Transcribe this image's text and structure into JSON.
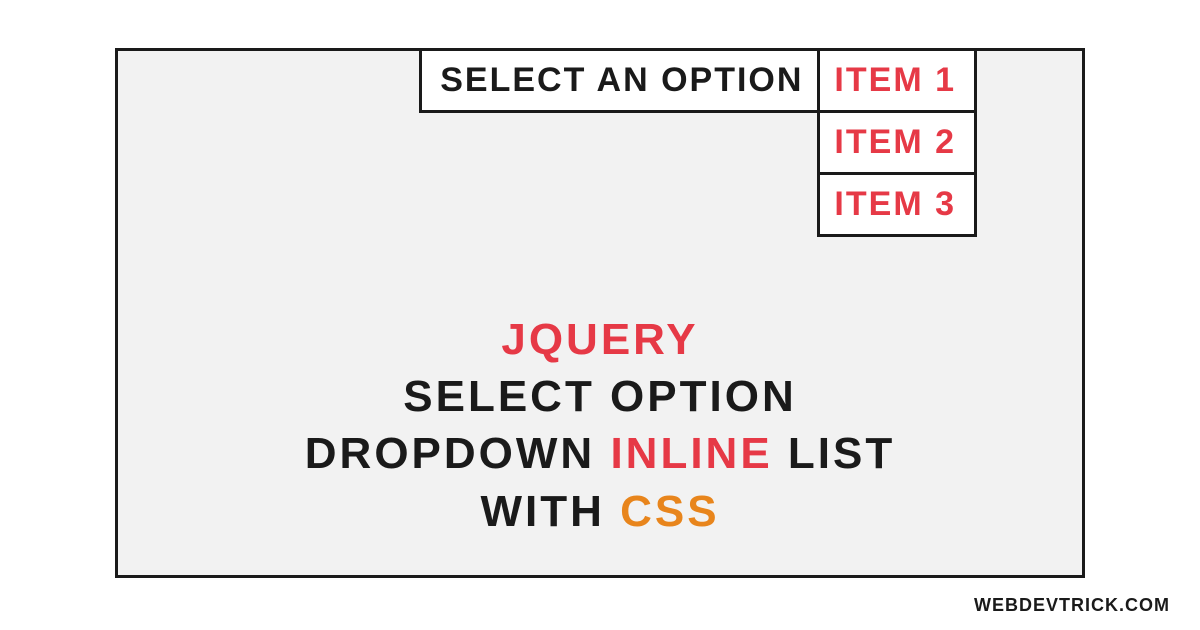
{
  "dropdown": {
    "label": "SELECT AN OPTION",
    "items": [
      "ITEM 1",
      "ITEM 2",
      "ITEM 3"
    ]
  },
  "title": {
    "word1": "JQUERY",
    "word2": "SELECT OPTION",
    "word3a": "DROPDOWN",
    "word3b": "INLINE",
    "word3c": "LIST",
    "word4a": "WITH",
    "word4b": "CSS"
  },
  "watermark": "WEBDEVTRICK.COM",
  "colors": {
    "red": "#e63946",
    "dark": "#1a1a1a",
    "orange": "#e8851c",
    "bg": "#f2f2f2"
  }
}
